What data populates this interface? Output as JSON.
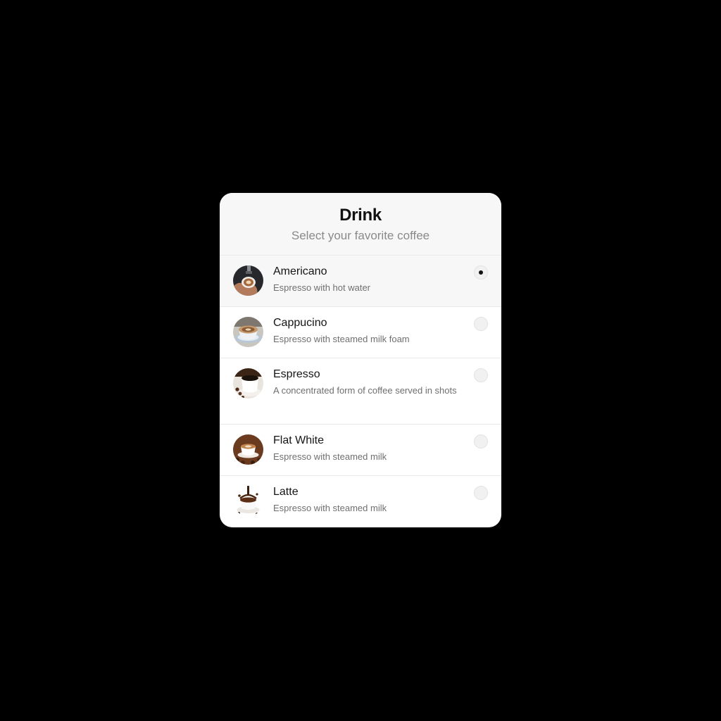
{
  "header": {
    "title": "Drink",
    "subtitle": "Select your favorite coffee"
  },
  "options": [
    {
      "name": "Americano",
      "description": "Espresso with hot water",
      "selected": true,
      "icon": "americano-thumbnail"
    },
    {
      "name": "Cappucino",
      "description": "Espresso with steamed milk foam",
      "selected": false,
      "icon": "cappucino-thumbnail"
    },
    {
      "name": "Espresso",
      "description": "A concentrated form of coffee served in shots",
      "selected": false,
      "icon": "espresso-thumbnail"
    },
    {
      "name": "Flat White",
      "description": "Espresso with steamed milk",
      "selected": false,
      "icon": "flat-white-thumbnail"
    },
    {
      "name": "Latte",
      "description": "Espresso with steamed milk",
      "selected": false,
      "icon": "latte-thumbnail"
    }
  ],
  "colors": {
    "background": "#000000",
    "card": "#ffffff",
    "header": "#f7f7f7",
    "selected_row": "#f7f7f7",
    "radio_dot": "#111111"
  }
}
